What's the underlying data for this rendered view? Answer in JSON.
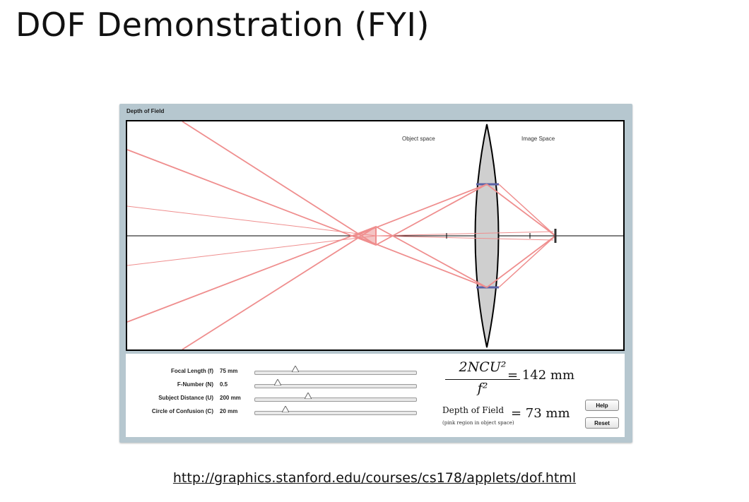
{
  "slide": {
    "title": "DOF Demonstration (FYI)",
    "url": "http://graphics.stanford.edu/courses/cs178/applets/dof.html"
  },
  "applet": {
    "title": "Depth of Field",
    "diagram": {
      "object_space_label": "Object space",
      "image_space_label": "Image Space",
      "ray_color": "#ef8e8e",
      "dof_region_color": "#f4c4c4",
      "lens_fill": "#cfcfcf",
      "aperture_color": "#5b63a8"
    },
    "controls": [
      {
        "label": "Focal Length (f)",
        "value": "75 mm",
        "slider_fraction": 0.25
      },
      {
        "label": "F-Number (N)",
        "value": "0.5",
        "slider_fraction": 0.14
      },
      {
        "label": "Subject Distance (U)",
        "value": "200 mm",
        "slider_fraction": 0.33
      },
      {
        "label": "Circle of Confusion (C)",
        "value": "20 mm",
        "slider_fraction": 0.19
      }
    ],
    "formula": {
      "numerator": "2NCU²",
      "denominator": "f²",
      "result": "= 142 mm"
    },
    "depth_of_field": {
      "label": "Depth of Field",
      "sublabel": "(pink region in object space)",
      "result": "= 73 mm"
    },
    "buttons": {
      "help": "Help",
      "reset": "Reset"
    }
  }
}
